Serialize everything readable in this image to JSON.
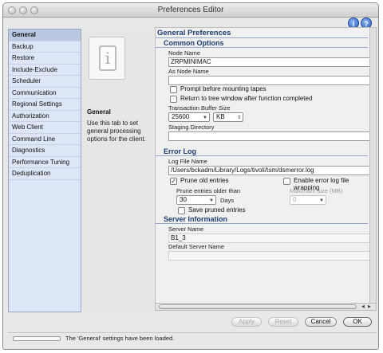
{
  "window": {
    "title": "Preferences Editor"
  },
  "sidebar": {
    "items": [
      {
        "label": "General",
        "selected": true
      },
      {
        "label": "Backup"
      },
      {
        "label": "Restore"
      },
      {
        "label": "Include-Exclude"
      },
      {
        "label": "Scheduler"
      },
      {
        "label": "Communication"
      },
      {
        "label": "Regional Settings"
      },
      {
        "label": "Authorization"
      },
      {
        "label": "Web Client"
      },
      {
        "label": "Command Line"
      },
      {
        "label": "Diagnostics"
      },
      {
        "label": "Performance Tuning"
      },
      {
        "label": "Deduplication"
      }
    ]
  },
  "description": {
    "icon": "info-icon",
    "title": "General",
    "text": "Use this tab to set general processing options for the client."
  },
  "main": {
    "heading": "General Preferences",
    "common": {
      "heading": "Common Options",
      "node_name_label": "Node Name",
      "node_name_value": "ZRPMINIMAC",
      "as_node_name_label": "As Node Name",
      "as_node_name_value": "",
      "prompt_tapes_label": "Prompt before mounting tapes",
      "prompt_tapes_checked": false,
      "return_tree_label": "Return to tree window after function completed",
      "return_tree_checked": false,
      "buffer_size_label": "Transaction Buffer Size",
      "buffer_size_value": "25600",
      "buffer_unit_value": "KB",
      "staging_dir_label": "Staging Directory",
      "staging_dir_value": ""
    },
    "error_log": {
      "heading": "Error Log",
      "file_name_label": "Log File Name",
      "file_name_value": "/Users/bckadm/Library/Logs/tivoli/tsm/dsmerror.log",
      "prune_label": "Prune old entries",
      "prune_checked": true,
      "wrapping_label": "Enable error log file wrapping",
      "wrapping_checked": false,
      "prune_older_label": "Prune entries older than",
      "prune_older_value": "30",
      "days_label": "Days",
      "max_size_label": "Maximum size (MB)",
      "max_size_value": "0",
      "save_pruned_label": "Save pruned entries",
      "save_pruned_checked": false
    },
    "server": {
      "heading": "Server Information",
      "server_name_label": "Server Name",
      "server_name_value": "B1_3",
      "default_server_label": "Default Server Name",
      "default_server_value": ""
    }
  },
  "buttons": {
    "apply": "Apply",
    "reset": "Reset",
    "cancel": "Cancel",
    "ok": "OK"
  },
  "status": {
    "text": "The 'General' settings have been loaded."
  },
  "colors": {
    "sidebar_bg": "#dce6f6",
    "section_header": "#1c3e74",
    "help_icon": "#2a5fbe"
  }
}
